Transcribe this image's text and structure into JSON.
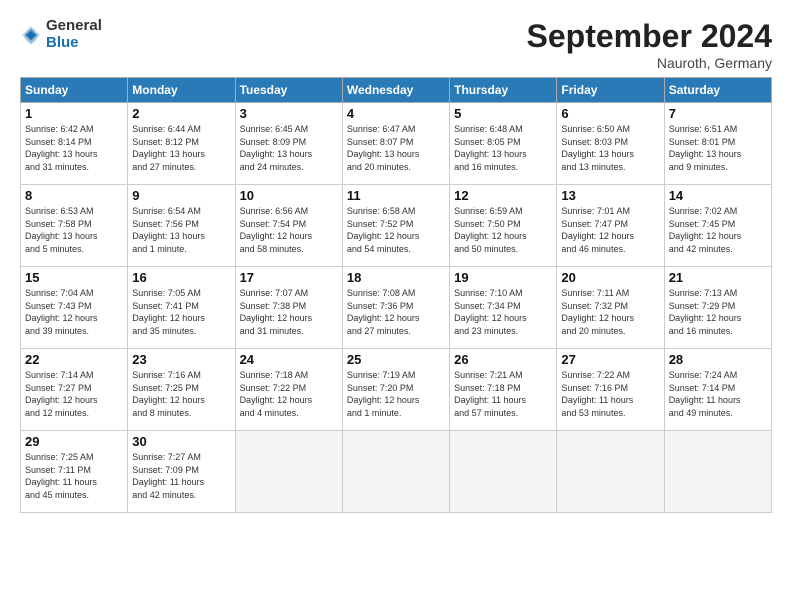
{
  "header": {
    "logo_general": "General",
    "logo_blue": "Blue",
    "month_year": "September 2024",
    "location": "Nauroth, Germany"
  },
  "days_of_week": [
    "Sunday",
    "Monday",
    "Tuesday",
    "Wednesday",
    "Thursday",
    "Friday",
    "Saturday"
  ],
  "weeks": [
    [
      {
        "day": 1,
        "lines": [
          "Sunrise: 6:42 AM",
          "Sunset: 8:14 PM",
          "Daylight: 13 hours",
          "and 31 minutes."
        ]
      },
      {
        "day": 2,
        "lines": [
          "Sunrise: 6:44 AM",
          "Sunset: 8:12 PM",
          "Daylight: 13 hours",
          "and 27 minutes."
        ]
      },
      {
        "day": 3,
        "lines": [
          "Sunrise: 6:45 AM",
          "Sunset: 8:09 PM",
          "Daylight: 13 hours",
          "and 24 minutes."
        ]
      },
      {
        "day": 4,
        "lines": [
          "Sunrise: 6:47 AM",
          "Sunset: 8:07 PM",
          "Daylight: 13 hours",
          "and 20 minutes."
        ]
      },
      {
        "day": 5,
        "lines": [
          "Sunrise: 6:48 AM",
          "Sunset: 8:05 PM",
          "Daylight: 13 hours",
          "and 16 minutes."
        ]
      },
      {
        "day": 6,
        "lines": [
          "Sunrise: 6:50 AM",
          "Sunset: 8:03 PM",
          "Daylight: 13 hours",
          "and 13 minutes."
        ]
      },
      {
        "day": 7,
        "lines": [
          "Sunrise: 6:51 AM",
          "Sunset: 8:01 PM",
          "Daylight: 13 hours",
          "and 9 minutes."
        ]
      }
    ],
    [
      {
        "day": 8,
        "lines": [
          "Sunrise: 6:53 AM",
          "Sunset: 7:58 PM",
          "Daylight: 13 hours",
          "and 5 minutes."
        ]
      },
      {
        "day": 9,
        "lines": [
          "Sunrise: 6:54 AM",
          "Sunset: 7:56 PM",
          "Daylight: 13 hours",
          "and 1 minute."
        ]
      },
      {
        "day": 10,
        "lines": [
          "Sunrise: 6:56 AM",
          "Sunset: 7:54 PM",
          "Daylight: 12 hours",
          "and 58 minutes."
        ]
      },
      {
        "day": 11,
        "lines": [
          "Sunrise: 6:58 AM",
          "Sunset: 7:52 PM",
          "Daylight: 12 hours",
          "and 54 minutes."
        ]
      },
      {
        "day": 12,
        "lines": [
          "Sunrise: 6:59 AM",
          "Sunset: 7:50 PM",
          "Daylight: 12 hours",
          "and 50 minutes."
        ]
      },
      {
        "day": 13,
        "lines": [
          "Sunrise: 7:01 AM",
          "Sunset: 7:47 PM",
          "Daylight: 12 hours",
          "and 46 minutes."
        ]
      },
      {
        "day": 14,
        "lines": [
          "Sunrise: 7:02 AM",
          "Sunset: 7:45 PM",
          "Daylight: 12 hours",
          "and 42 minutes."
        ]
      }
    ],
    [
      {
        "day": 15,
        "lines": [
          "Sunrise: 7:04 AM",
          "Sunset: 7:43 PM",
          "Daylight: 12 hours",
          "and 39 minutes."
        ]
      },
      {
        "day": 16,
        "lines": [
          "Sunrise: 7:05 AM",
          "Sunset: 7:41 PM",
          "Daylight: 12 hours",
          "and 35 minutes."
        ]
      },
      {
        "day": 17,
        "lines": [
          "Sunrise: 7:07 AM",
          "Sunset: 7:38 PM",
          "Daylight: 12 hours",
          "and 31 minutes."
        ]
      },
      {
        "day": 18,
        "lines": [
          "Sunrise: 7:08 AM",
          "Sunset: 7:36 PM",
          "Daylight: 12 hours",
          "and 27 minutes."
        ]
      },
      {
        "day": 19,
        "lines": [
          "Sunrise: 7:10 AM",
          "Sunset: 7:34 PM",
          "Daylight: 12 hours",
          "and 23 minutes."
        ]
      },
      {
        "day": 20,
        "lines": [
          "Sunrise: 7:11 AM",
          "Sunset: 7:32 PM",
          "Daylight: 12 hours",
          "and 20 minutes."
        ]
      },
      {
        "day": 21,
        "lines": [
          "Sunrise: 7:13 AM",
          "Sunset: 7:29 PM",
          "Daylight: 12 hours",
          "and 16 minutes."
        ]
      }
    ],
    [
      {
        "day": 22,
        "lines": [
          "Sunrise: 7:14 AM",
          "Sunset: 7:27 PM",
          "Daylight: 12 hours",
          "and 12 minutes."
        ]
      },
      {
        "day": 23,
        "lines": [
          "Sunrise: 7:16 AM",
          "Sunset: 7:25 PM",
          "Daylight: 12 hours",
          "and 8 minutes."
        ]
      },
      {
        "day": 24,
        "lines": [
          "Sunrise: 7:18 AM",
          "Sunset: 7:22 PM",
          "Daylight: 12 hours",
          "and 4 minutes."
        ]
      },
      {
        "day": 25,
        "lines": [
          "Sunrise: 7:19 AM",
          "Sunset: 7:20 PM",
          "Daylight: 12 hours",
          "and 1 minute."
        ]
      },
      {
        "day": 26,
        "lines": [
          "Sunrise: 7:21 AM",
          "Sunset: 7:18 PM",
          "Daylight: 11 hours",
          "and 57 minutes."
        ]
      },
      {
        "day": 27,
        "lines": [
          "Sunrise: 7:22 AM",
          "Sunset: 7:16 PM",
          "Daylight: 11 hours",
          "and 53 minutes."
        ]
      },
      {
        "day": 28,
        "lines": [
          "Sunrise: 7:24 AM",
          "Sunset: 7:14 PM",
          "Daylight: 11 hours",
          "and 49 minutes."
        ]
      }
    ],
    [
      {
        "day": 29,
        "lines": [
          "Sunrise: 7:25 AM",
          "Sunset: 7:11 PM",
          "Daylight: 11 hours",
          "and 45 minutes."
        ]
      },
      {
        "day": 30,
        "lines": [
          "Sunrise: 7:27 AM",
          "Sunset: 7:09 PM",
          "Daylight: 11 hours",
          "and 42 minutes."
        ]
      },
      null,
      null,
      null,
      null,
      null
    ]
  ]
}
